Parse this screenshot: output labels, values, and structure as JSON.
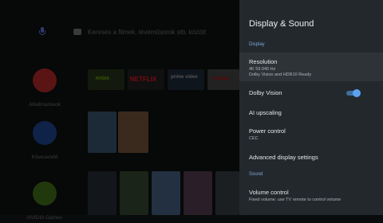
{
  "launcher": {
    "search_placeholder": "Keresés a filmek, tévéműsorok stb. között",
    "nav": [
      {
        "label": "Alkalmazások",
        "color": "#c62828"
      },
      {
        "label": "Kövesendő",
        "color": "#1e4fa8"
      },
      {
        "label": "NVIDIA Games",
        "color": "#4c8a1c"
      }
    ],
    "apps_row": [
      {
        "label": "NVIDIA",
        "bg": "#1f2a14",
        "fg": "#76b900"
      },
      {
        "label": "NETFLIX",
        "bg": "#171717",
        "fg": "#e50914"
      },
      {
        "label": "prime video",
        "bg": "#1b2633",
        "fg": "#ffffff"
      },
      {
        "label": "YouTube",
        "bg": "#2b2b2b",
        "fg": "#ff0000"
      }
    ]
  },
  "panel": {
    "title": "Display & Sound",
    "section_display": "Display",
    "section_sound": "Sound",
    "resolution": {
      "label": "Resolution",
      "value": "4K 59.940 Hz",
      "detail": "Dolby Vision and HDR10 Ready"
    },
    "dolby_vision": {
      "label": "Dolby Vision",
      "enabled": true
    },
    "ai_upscaling": {
      "label": "AI upscaling"
    },
    "power_control": {
      "label": "Power control",
      "value": "CEC"
    },
    "advanced": {
      "label": "Advanced display settings"
    },
    "volume_control": {
      "label": "Volume control",
      "value": "Fixed volume: use TV remote to control volume"
    }
  }
}
